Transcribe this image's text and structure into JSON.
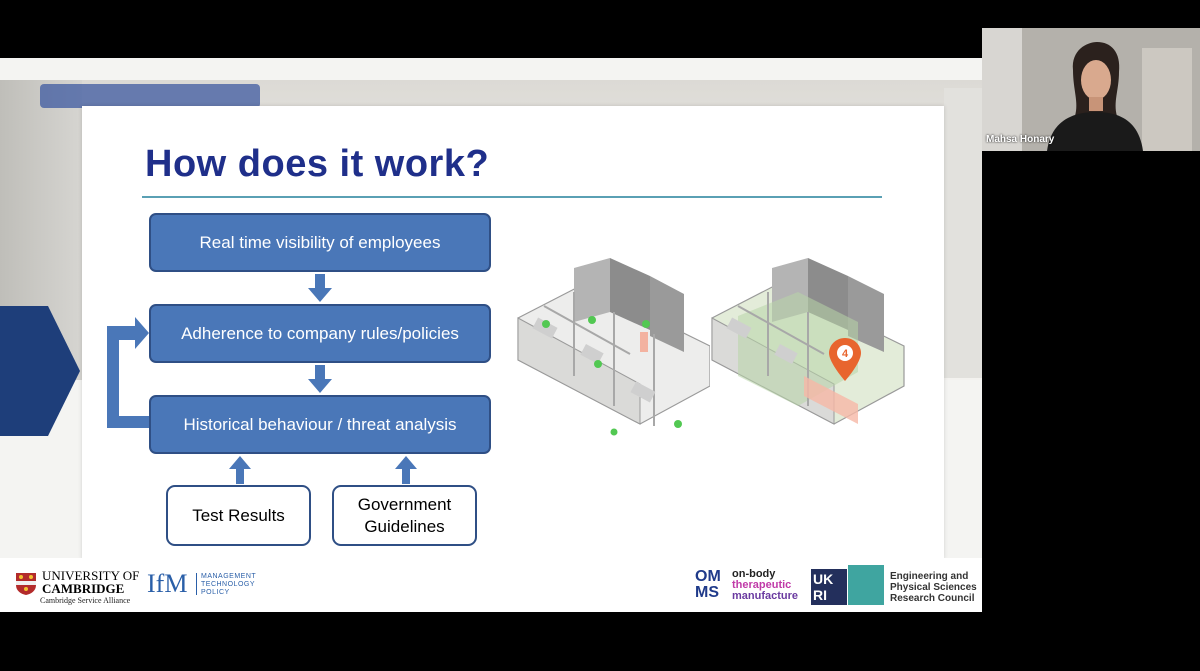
{
  "slide": {
    "title": "How does it work?",
    "flow_steps": [
      "Real time visibility of employees",
      "Adherence to company rules/policies",
      "Historical behaviour / threat analysis"
    ],
    "inputs": [
      "Test Results",
      "Government\nGuidelines"
    ],
    "map_pin_label": "4",
    "colors": {
      "title": "#1f2f8a",
      "box_fill": "#4a77b8",
      "box_border": "#2f4f85",
      "rule": "#5aa0b4",
      "dot": "#52c852",
      "pin": "#e8652e"
    }
  },
  "logos": {
    "cambridge_line1": "UNIVERSITY OF",
    "cambridge_line2": "CAMBRIDGE",
    "cambridge_sub": "Cambridge Service Alliance",
    "ifm_mark": "IfM",
    "ifm_lines": [
      "MANAGEMENT",
      "TECHNOLOGY",
      "POLICY"
    ],
    "omms_mark": "OM MS",
    "omms_lines": [
      "on-body",
      "therapeutic",
      "manufacture"
    ],
    "ukri_mark": "UK RI",
    "epsrc_lines": [
      "Engineering and",
      "Physical Sciences",
      "Research Council"
    ]
  },
  "participant": {
    "name": "Mahsa Honary"
  }
}
